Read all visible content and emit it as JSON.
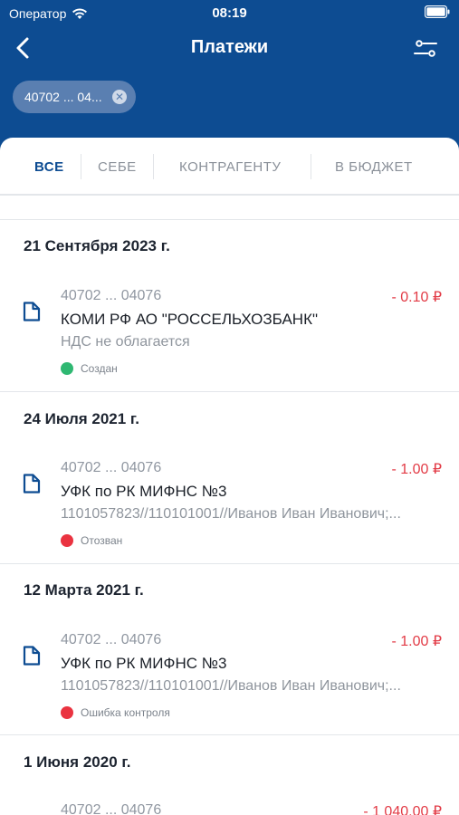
{
  "status_bar": {
    "carrier": "Оператор",
    "time": "08:19"
  },
  "nav": {
    "title": "Платежи"
  },
  "chip": {
    "label": "40702 ... 04..."
  },
  "tabs": [
    {
      "label": "ВСЕ"
    },
    {
      "label": "СЕБЕ"
    },
    {
      "label": "КОНТРАГЕНТУ"
    },
    {
      "label": "В БЮДЖЕТ"
    }
  ],
  "colors": {
    "header": "#0d4c92",
    "amount": "#e23a45",
    "created": "#2fb872",
    "error": "#ea3340"
  },
  "groups": [
    {
      "date": "21 Сентября 2023 г.",
      "item": {
        "account": "40702 ... 04076",
        "amount": "- 0.10 ₽",
        "name": "КОМИ РФ АО \"РОССЕЛЬХОЗБАНК\"",
        "description": "НДС не облагается",
        "status": "Создан",
        "status_color": "#2fb872"
      }
    },
    {
      "date": "24 Июля 2021 г.",
      "item": {
        "account": "40702 ... 04076",
        "amount": "- 1.00 ₽",
        "name": "УФК по РК МИФНС №3",
        "description": "1101057823//110101001//Иванов Иван Иванович;...",
        "status": "Отозван",
        "status_color": "#ea3340"
      }
    },
    {
      "date": "12 Марта 2021 г.",
      "item": {
        "account": "40702 ... 04076",
        "amount": "- 1.00 ₽",
        "name": "УФК по РК МИФНС №3",
        "description": "1101057823//110101001//Иванов Иван Иванович;...",
        "status": "Ошибка контроля",
        "status_color": "#ea3340"
      }
    },
    {
      "date": "1 Июня 2020 г.",
      "item": {
        "account": "40702 ... 04076",
        "amount": "- 1 040.00 ₽"
      }
    }
  ]
}
